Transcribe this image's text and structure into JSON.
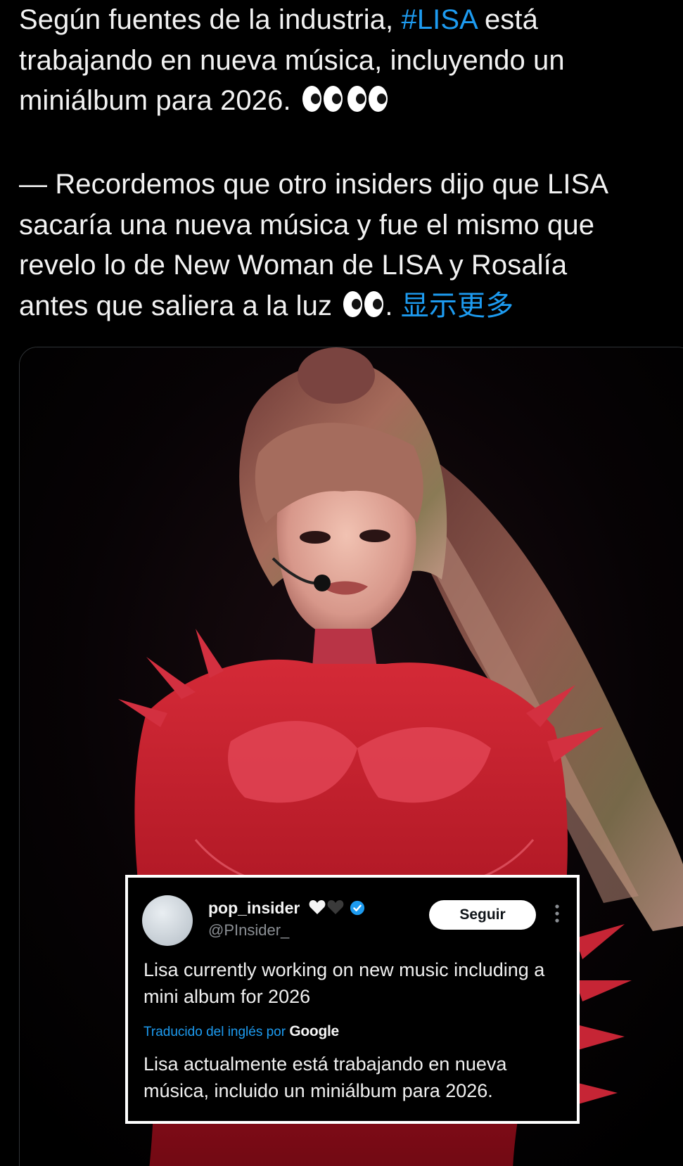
{
  "tweet": {
    "line1_pre": "Según fuentes de la industria, ",
    "hashtag": "#LISA",
    "line1_post": " está",
    "line2": "trabajando en nueva música, incluyendo un",
    "line3": "miniálbum para 2026.",
    "para2_line1": "— Recordemos que otro insiders dijo que LISA",
    "para2_line2": "sacaría una nueva música y fue el mismo que",
    "para2_line3": "revelo lo de New Woman de LISA y Rosalía",
    "para2_line4_pre": "antes que saliera a la luz",
    "para2_line4_punct": ".",
    "show_more": "显示更多"
  },
  "icons": {
    "eyes": "eyes-emoji",
    "verified": "verified-badge-icon",
    "more": "more-vertical-icon"
  },
  "quoted_post": {
    "name": "pop_insider",
    "handle": "@PInsider_",
    "follow_label": "Seguir",
    "text": "Lisa currently working on new music including a mini album for 2026",
    "translated_by": "Traducido del inglés por",
    "translator_brand": "Google",
    "translated_text": "Lisa actualmente está trabajando en nueva música, incluido un miniálbum para 2026."
  },
  "colors": {
    "background": "#000000",
    "link": "#1d9bf0",
    "costume_red": "#c21e2e"
  }
}
